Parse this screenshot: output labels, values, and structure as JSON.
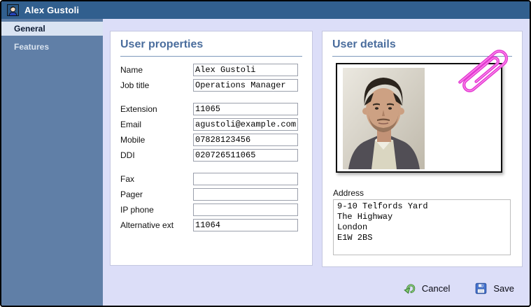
{
  "window": {
    "title": "Alex Gustoli"
  },
  "sidebar": {
    "items": [
      {
        "label": "General",
        "selected": true
      },
      {
        "label": "Features",
        "selected": false
      }
    ]
  },
  "user_properties": {
    "title": "User properties",
    "groups": [
      {
        "fields": [
          {
            "label": "Name",
            "value": "Alex Gustoli"
          },
          {
            "label": "Job title",
            "value": "Operations Manager"
          }
        ]
      },
      {
        "fields": [
          {
            "label": "Extension",
            "value": "11065"
          },
          {
            "label": "Email",
            "value": "agustoli@example.com"
          },
          {
            "label": "Mobile",
            "value": "07828123456"
          },
          {
            "label": "DDI",
            "value": "020726511065"
          }
        ]
      },
      {
        "fields": [
          {
            "label": "Fax",
            "value": ""
          },
          {
            "label": "Pager",
            "value": ""
          },
          {
            "label": "IP phone",
            "value": ""
          },
          {
            "label": "Alternative ext",
            "value": "11064"
          }
        ]
      }
    ]
  },
  "user_details": {
    "title": "User details",
    "address_label": "Address",
    "address_value": "9-10 Telfords Yard\nThe Highway\nLondon\nE1W 2BS"
  },
  "footer": {
    "cancel_label": "Cancel",
    "save_label": "Save"
  },
  "icons": {
    "titlebar": "person-icon",
    "cancel": "undo-arrow-icon",
    "save": "floppy-disk-icon",
    "attachment": "paperclip-icon"
  },
  "colors": {
    "titlebar": "#315f8e",
    "sidebar": "#607fa7",
    "sidebar_selected_bg": "#d9e3f2",
    "heading": "#4a6d9d",
    "background": "#dcdef8",
    "paperclip": "#e23ad2",
    "save_blue": "#4a79d9",
    "cancel_green": "#7fc96f"
  }
}
